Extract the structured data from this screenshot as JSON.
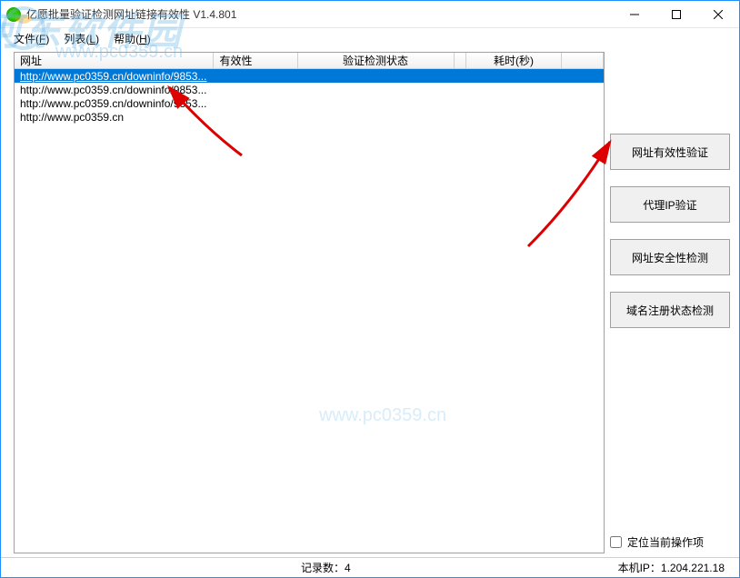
{
  "window": {
    "title": "亿愿批量验证检测网址链接有效性 V1.4.801"
  },
  "menu": {
    "file": "文件",
    "file_key": "F",
    "list": "列表",
    "list_key": "L",
    "help": "帮助",
    "help_key": "H"
  },
  "watermark": {
    "text": "河东软件园",
    "url": "www.pc0359.cn",
    "url2": "www.pc0359.cn"
  },
  "table": {
    "headers": {
      "url": "网址",
      "valid": "有效性",
      "status": "验证检测状态",
      "time": "耗时(秒)"
    },
    "rows": [
      {
        "url": "http://www.pc0359.cn/downinfo/9853...",
        "selected": true
      },
      {
        "url": "http://www.pc0359.cn/downinfo/9853...",
        "selected": false
      },
      {
        "url": "http://www.pc0359.cn/downinfo/9853...",
        "selected": false
      },
      {
        "url": "http://www.pc0359.cn",
        "selected": false
      }
    ]
  },
  "sidebar": {
    "validate_url": "网址有效性验证",
    "validate_proxy": "代理IP验证",
    "scan_safety": "网址安全性检测",
    "scan_domain": "域名注册状态检测",
    "locate_current": "定位当前操作项"
  },
  "status": {
    "record_count_label": "记录数：",
    "record_count_value": "4",
    "local_ip_label": "本机IP：",
    "local_ip_value": "1.204.221.18"
  }
}
